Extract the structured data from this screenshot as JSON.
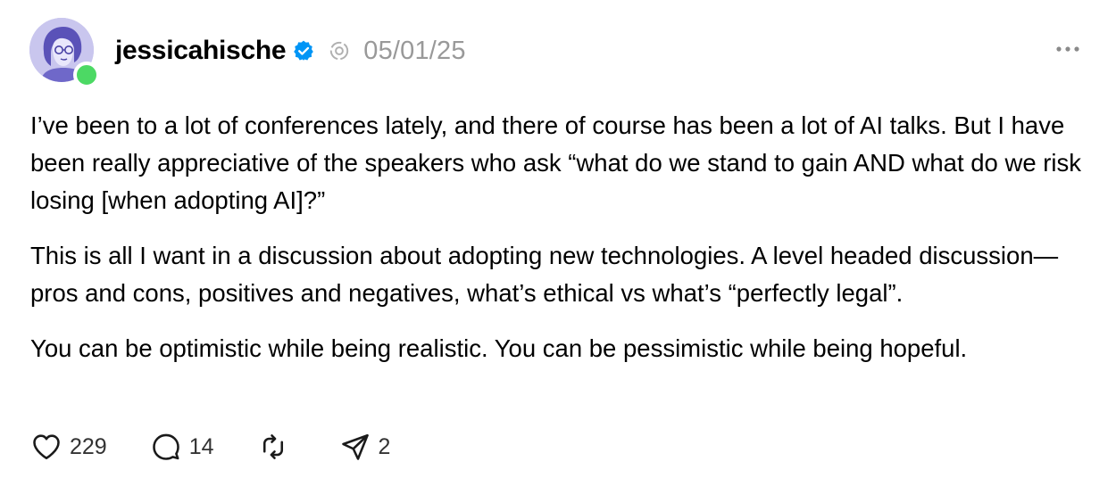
{
  "post": {
    "author": {
      "username": "jessicahische",
      "verified": true,
      "online": true,
      "avatar_icon": "avatar-illustration"
    },
    "date": "05/01/25",
    "ai_badge_icon": "ai-label-icon",
    "more_icon": "more-dots-icon",
    "paragraphs": [
      "I’ve been to a lot of conferences lately, and there of course has been a lot of AI talks. But I have been really appreciative of the speakers who ask “what do we stand to gain AND what do we risk losing [when adopting AI]?”",
      "This is all I want in a discussion about adopting new technologies. A level headed discussion—pros and cons, positives and negatives, what’s ethical vs what’s “perfectly legal”.",
      "You can be optimistic while being realistic. You can be pessimistic while being hopeful."
    ],
    "actions": {
      "likes": "229",
      "replies": "14",
      "reposts": "",
      "shares": "2"
    }
  },
  "colors": {
    "verified_blue": "#0095f6",
    "online_green": "#4cd964",
    "muted_gray": "#999999",
    "avatar_bg": "#c9c6ee"
  }
}
